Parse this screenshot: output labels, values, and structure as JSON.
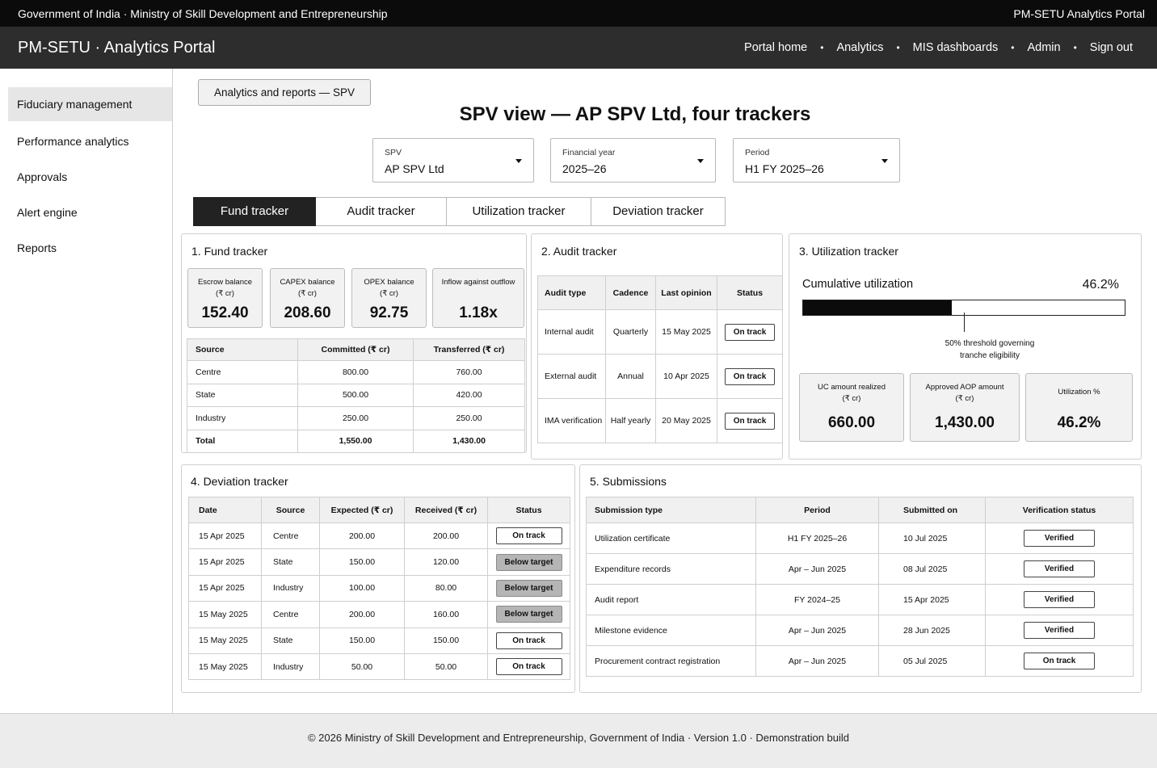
{
  "topbar": {
    "left_text": "Government of India · Ministry of Skill Development and Entrepreneurship",
    "right_text": "PM-SETU Analytics Portal"
  },
  "navbar": {
    "brand": "PM-SETU · Analytics Portal",
    "links": [
      "Portal home",
      "Analytics",
      "MIS dashboards",
      "Admin",
      "Sign out"
    ],
    "separator": "•"
  },
  "sidebar": {
    "items": [
      "Fiduciary management",
      "Performance analytics",
      "Approvals",
      "Alert engine",
      "Reports"
    ],
    "active_index": 0
  },
  "breadcrumb": "Analytics and reports — SPV",
  "page_title": "SPV view — AP SPV Ltd, four trackers",
  "filters": [
    {
      "label": "SPV",
      "value": "AP SPV Ltd"
    },
    {
      "label": "Financial year",
      "value": "2025–26"
    },
    {
      "label": "Period",
      "value": "H1 FY 2025–26"
    }
  ],
  "tabs": [
    "Fund tracker",
    "Audit tracker",
    "Utilization tracker",
    "Deviation tracker"
  ],
  "active_tab": 0,
  "fund_tracker": {
    "title": "1.  Fund tracker",
    "kpis": [
      {
        "label1": "Escrow balance",
        "label2": "(₹ cr)",
        "value": "152.40"
      },
      {
        "label1": "CAPEX balance",
        "label2": "(₹ cr)",
        "value": "208.60"
      },
      {
        "label1": "OPEX balance",
        "label2": "(₹ cr)",
        "value": "92.75"
      },
      {
        "label1": "Inflow against outflow",
        "label2": "",
        "value": "1.18x"
      }
    ],
    "columns": [
      "Source",
      "Committed (₹ cr)",
      "Transferred (₹ cr)"
    ],
    "rows": [
      [
        "Centre",
        "800.00",
        "760.00"
      ],
      [
        "State",
        "500.00",
        "420.00"
      ],
      [
        "Industry",
        "250.00",
        "250.00"
      ],
      [
        "Total",
        "1,550.00",
        "1,430.00"
      ]
    ]
  },
  "audit_tracker": {
    "title": "2.  Audit tracker",
    "columns": [
      "Audit type",
      "Cadence",
      "Last opinion",
      "Status"
    ],
    "rows": [
      [
        "Internal audit",
        "Quarterly",
        "15 May 2025",
        "On track"
      ],
      [
        "External audit",
        "Annual",
        "10 Apr 2025",
        "On track"
      ],
      [
        "IMA verification",
        "Half yearly",
        "20 May 2025",
        "On track"
      ]
    ]
  },
  "utilization_tracker": {
    "title": "3.  Utilization tracker",
    "cumulative_label": "Cumulative utilization",
    "cumulative_value": "46.2%",
    "progress_fraction": 0.462,
    "threshold_fraction": 0.5,
    "threshold_note_1": "50% threshold governing",
    "threshold_note_2": "tranche eligibility",
    "kpis": [
      {
        "label1": "UC amount realized",
        "label2": "(₹ cr)",
        "value": "660.00"
      },
      {
        "label1": "Approved AOP amount",
        "label2": "(₹ cr)",
        "value": "1,430.00"
      },
      {
        "label1": "Utilization %",
        "label2": "",
        "value": "46.2%"
      }
    ]
  },
  "deviation_tracker": {
    "title": "4.  Deviation tracker",
    "columns": [
      "Date",
      "Source",
      "Expected (₹ cr)",
      "Received (₹ cr)",
      "Status"
    ],
    "rows": [
      [
        "15 Apr 2025",
        "Centre",
        "200.00",
        "200.00",
        "On track"
      ],
      [
        "15 Apr 2025",
        "State",
        "150.00",
        "120.00",
        "Below target"
      ],
      [
        "15 Apr 2025",
        "Industry",
        "100.00",
        "80.00",
        "Below target"
      ],
      [
        "15 May 2025",
        "Centre",
        "200.00",
        "160.00",
        "Below target"
      ],
      [
        "15 May 2025",
        "State",
        "150.00",
        "150.00",
        "On track"
      ],
      [
        "15 May 2025",
        "Industry",
        "50.00",
        "50.00",
        "On track"
      ]
    ]
  },
  "submissions": {
    "title": "5.  Submissions",
    "columns": [
      "Submission type",
      "Period",
      "Submitted on",
      "Verification status"
    ],
    "rows": [
      [
        "Utilization certificate",
        "H1 FY 2025–26",
        "10 Jul 2025",
        "Verified"
      ],
      [
        "Expenditure records",
        "Apr – Jun 2025",
        "08 Jul 2025",
        "Verified"
      ],
      [
        "Audit report",
        "FY 2024–25",
        "15 Apr 2025",
        "Verified"
      ],
      [
        "Milestone evidence",
        "Apr – Jun 2025",
        "28 Jun 2025",
        "Verified"
      ],
      [
        "Procurement contract registration",
        "Apr – Jun 2025",
        "05 Jul 2025",
        "On track"
      ]
    ]
  },
  "footer": "© 2026 Ministry of Skill Development and Entrepreneurship, Government of India  ·  Version 1.0  ·  Demonstration build"
}
